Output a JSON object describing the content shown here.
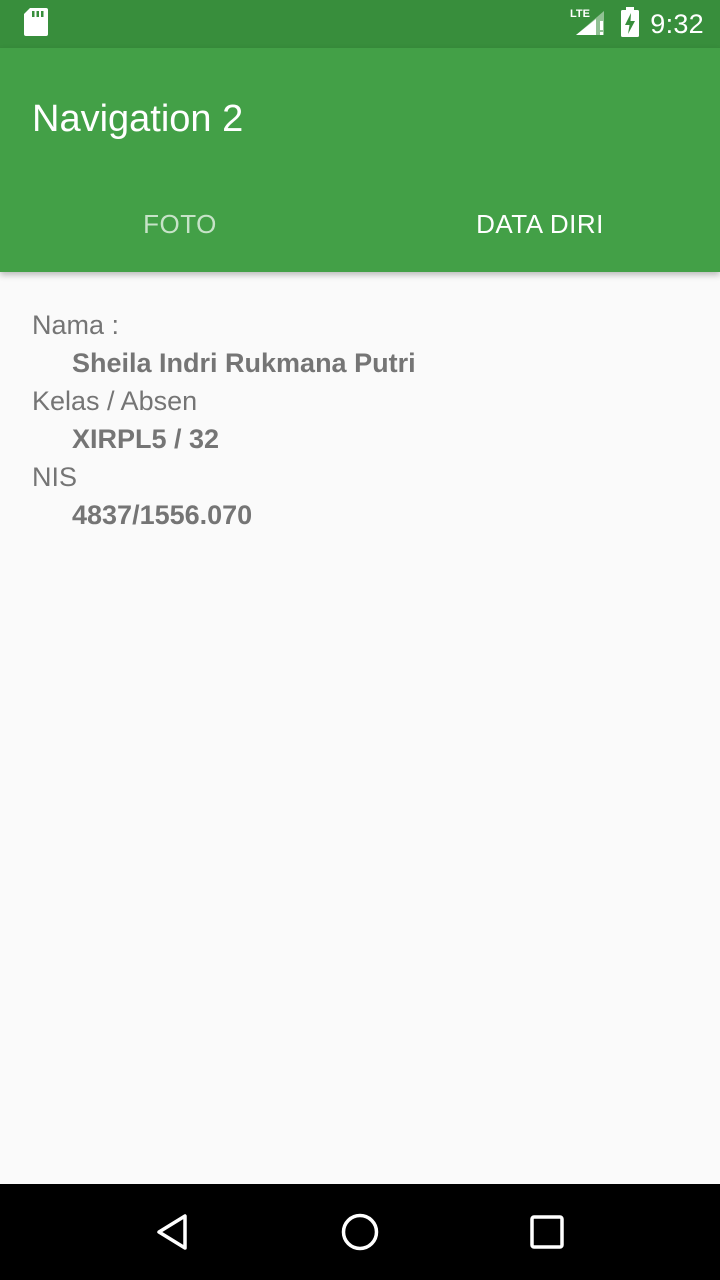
{
  "status_bar": {
    "network": "LTE",
    "time": "9:32"
  },
  "app_bar": {
    "title": "Navigation 2"
  },
  "tabs": [
    {
      "label": "FOTO",
      "selected": false
    },
    {
      "label": "DATA DIRI",
      "selected": true
    }
  ],
  "profile": {
    "name_label": "Nama :",
    "name_value": "Sheila Indri Rukmana Putri",
    "class_label": "Kelas / Absen",
    "class_value": "XIRPL5 / 32",
    "nis_label": "NIS",
    "nis_value": "4837/1556.070"
  },
  "colors": {
    "status_bar": "#388e3c",
    "app_bar": "#43a047",
    "text": "#757575"
  }
}
